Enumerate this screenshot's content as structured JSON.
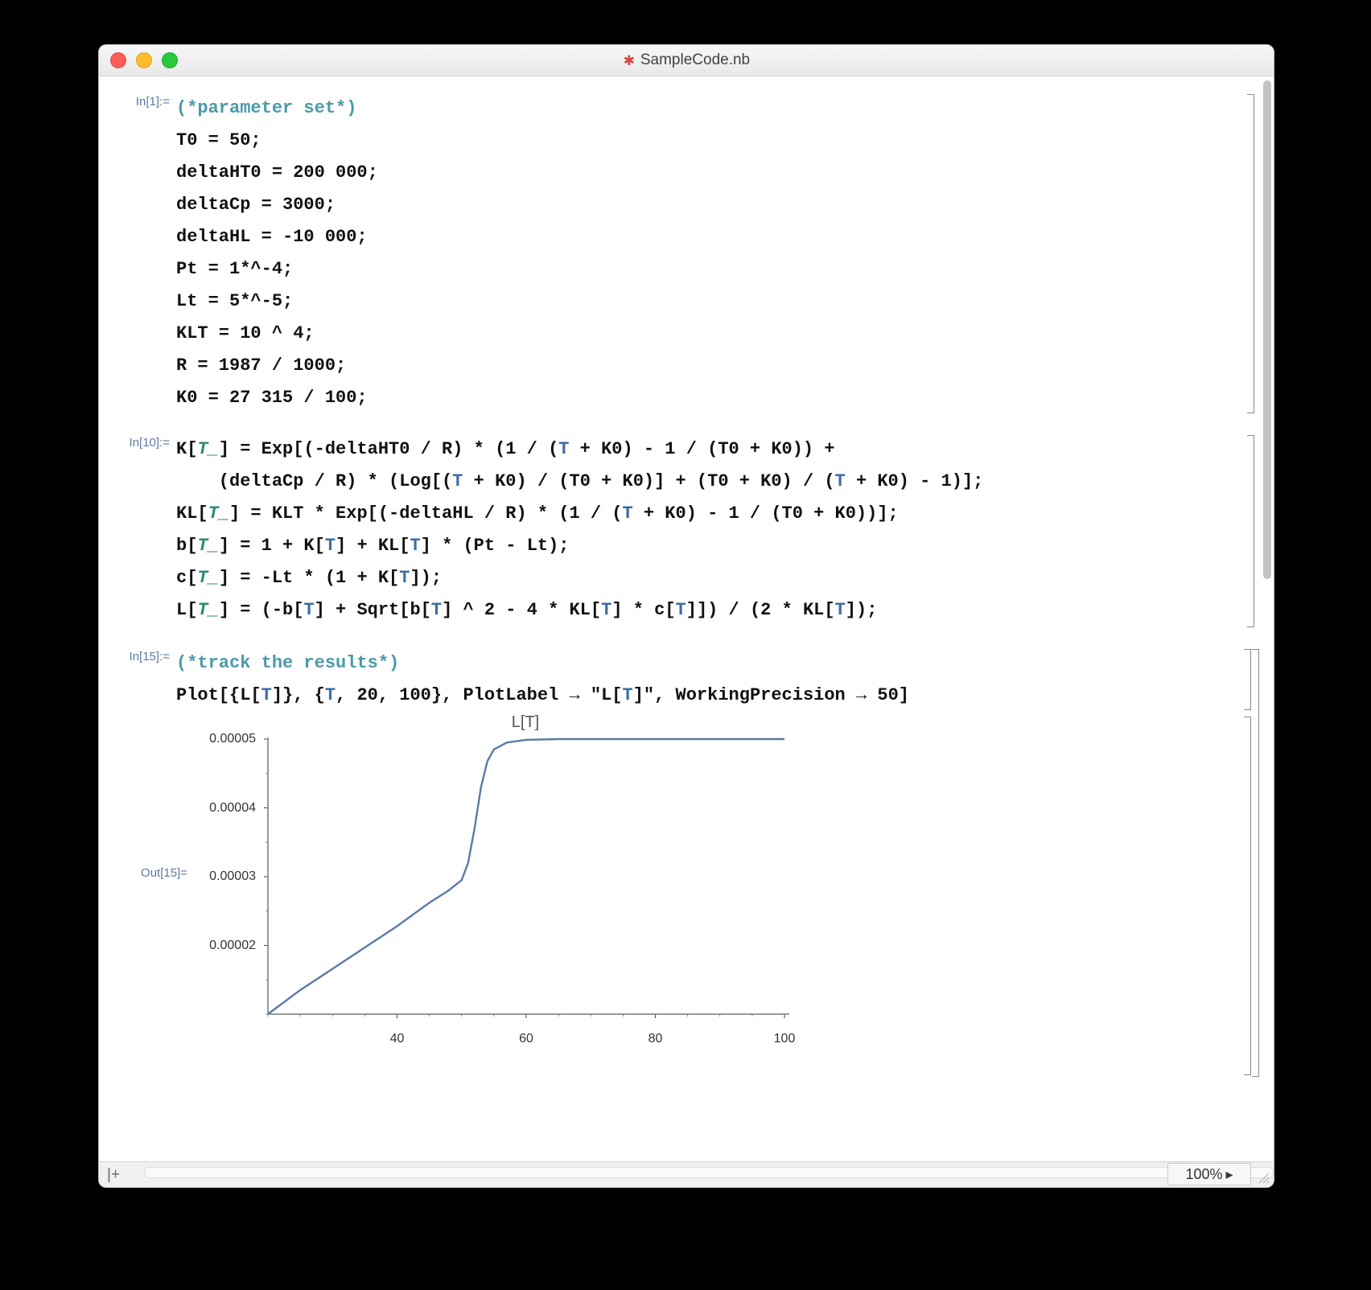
{
  "window": {
    "title": "SampleCode.nb",
    "zoom": "100%"
  },
  "cells": {
    "c1": {
      "prompt": "In[1]:=",
      "lines": [
        {
          "type": "comment",
          "text": "(*parameter set*)"
        },
        {
          "type": "code",
          "text": "T0 = 50;"
        },
        {
          "type": "code",
          "text": "deltaHT0 = 200 000;"
        },
        {
          "type": "code",
          "text": "deltaCp = 3000;"
        },
        {
          "type": "code",
          "text": "deltaHL = -10 000;"
        },
        {
          "type": "code",
          "text": "Pt = 1*^-4;"
        },
        {
          "type": "code",
          "text": "Lt = 5*^-5;"
        },
        {
          "type": "code",
          "text": "KLT = 10 ^ 4;"
        },
        {
          "type": "code",
          "text": "R = 1987 / 1000;"
        },
        {
          "type": "code",
          "text": "K0 = 27 315 / 100;"
        }
      ]
    },
    "c2": {
      "prompt": "In[10]:=",
      "lines": [
        "K[T_] = Exp[(-deltaHT0 / R) * (1 / (T + K0) - 1 / (T0 + K0)) +",
        "    (deltaCp / R) * (Log[(T + K0) / (T0 + K0)] + (T0 + K0) / (T + K0) - 1)];",
        "KL[T_] = KLT * Exp[(-deltaHL / R) * (1 / (T + K0) - 1 / (T0 + K0))];",
        "b[T_] = 1 + K[T] + KL[T] * (Pt - Lt);",
        "c[T_] = -Lt * (1 + K[T]);",
        "L[T_] = (-b[T] + Sqrt[b[T] ^ 2 - 4 * KL[T] * c[T]]) / (2 * KL[T]);"
      ]
    },
    "c3": {
      "prompt": "In[15]:=",
      "comment": "(*track the results*)",
      "plot_call": "Plot[{L[T]}, {T, 20, 100}, PlotLabel → \"L[T]\", WorkingPrecision → 50]",
      "out_prompt": "Out[15]="
    }
  },
  "chart_data": {
    "type": "line",
    "title": "L[T]",
    "xlabel": "",
    "ylabel": "",
    "xlim": [
      20,
      100
    ],
    "ylim": [
      1e-05,
      5e-05
    ],
    "xticks": [
      40,
      60,
      80,
      100
    ],
    "yticks": [
      2e-05,
      3e-05,
      4e-05,
      5e-05
    ],
    "series": [
      {
        "name": "L[T]",
        "color": "#5b7aa6",
        "x": [
          20,
          25,
          30,
          35,
          40,
          45,
          48,
          50,
          51,
          52,
          53,
          54,
          55,
          57,
          60,
          65,
          70,
          80,
          90,
          100
        ],
        "y": [
          1e-05,
          1.35e-05,
          1.66e-05,
          1.97e-05,
          2.28e-05,
          2.62e-05,
          2.8e-05,
          2.95e-05,
          3.2e-05,
          3.7e-05,
          4.3e-05,
          4.68e-05,
          4.85e-05,
          4.95e-05,
          4.99e-05,
          5e-05,
          5e-05,
          5e-05,
          5e-05,
          5e-05
        ]
      }
    ]
  }
}
